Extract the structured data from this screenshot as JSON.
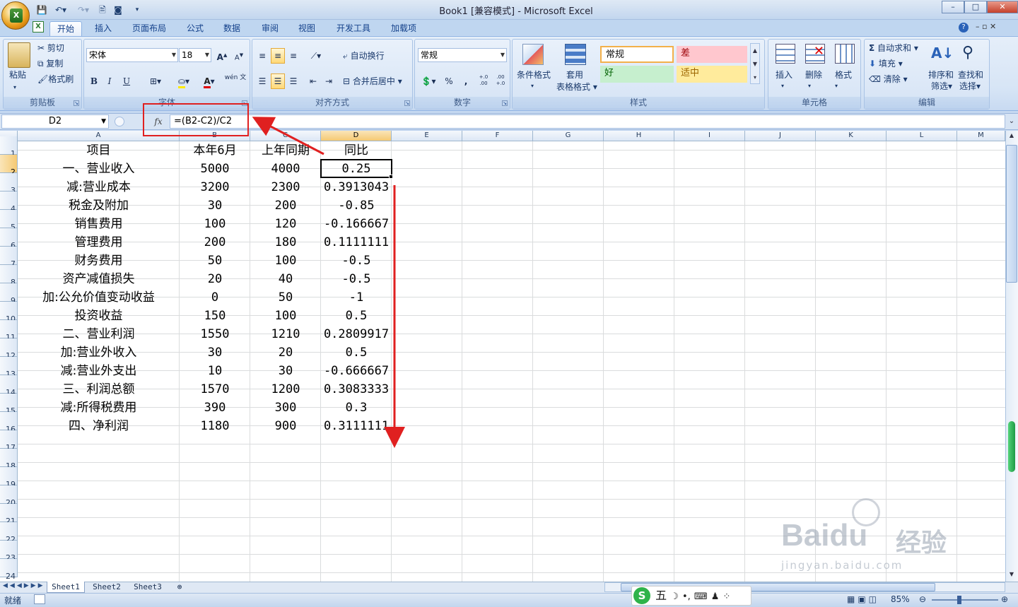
{
  "window": {
    "title": "Book1  [兼容模式] - Microsoft Excel",
    "min": "–",
    "max": "□",
    "close": "✕"
  },
  "office_button": {
    "label": "X"
  },
  "tabs": [
    "开始",
    "插入",
    "页面布局",
    "公式",
    "数据",
    "审阅",
    "视图",
    "开发工具",
    "加载项"
  ],
  "ribbon": {
    "clipboard": {
      "label": "剪贴板",
      "paste": "粘贴",
      "cut": "剪切",
      "copy": "复制",
      "format_painter": "格式刷"
    },
    "font": {
      "label": "字体",
      "font_name": "宋体",
      "font_size": "18",
      "bold": "B",
      "italic": "I",
      "underline": "U",
      "grow": "A",
      "shrink": "A",
      "wen": "wén 文"
    },
    "alignment": {
      "label": "对齐方式",
      "wrap": "自动换行",
      "merge": "合并后居中"
    },
    "number": {
      "label": "数字",
      "format": "常规",
      "percent": "%",
      "comma": ",",
      "inc": "+.0 .00",
      "dec": ".00 +.0"
    },
    "styles": {
      "label": "样式",
      "conditional": "条件格式",
      "table_top": "套用",
      "table_bottom": "表格格式",
      "normal": "常规",
      "bad": "差",
      "good": "好",
      "neutral": "适中"
    },
    "cells": {
      "label": "单元格",
      "insert": "插入",
      "delete": "删除",
      "format": "格式"
    },
    "editing": {
      "label": "编辑",
      "autosum": "自动求和",
      "fill": "填充",
      "clear": "清除",
      "sort_top": "排序和",
      "sort_bottom": "筛选",
      "find_top": "查找和",
      "find_bottom": "选择"
    }
  },
  "formula_bar": {
    "name_box": "D2",
    "fx": "fx",
    "formula": "=(B2-C2)/C2"
  },
  "columns": [
    "A",
    "B",
    "C",
    "D",
    "E",
    "F",
    "G",
    "H",
    "I",
    "J",
    "K",
    "L",
    "M"
  ],
  "rows": [
    "1",
    "2",
    "3",
    "4",
    "5",
    "6",
    "7",
    "8",
    "9",
    "10",
    "11",
    "12",
    "13",
    "14",
    "15",
    "16",
    "17",
    "18",
    "19",
    "20",
    "21",
    "22",
    "23",
    "24"
  ],
  "table": [
    [
      "项目",
      "本年6月",
      "上年同期",
      "同比"
    ],
    [
      "一、营业收入",
      "5000",
      "4000",
      "0.25"
    ],
    [
      "减:营业成本",
      "3200",
      "2300",
      "0.3913043"
    ],
    [
      "税金及附加",
      "30",
      "200",
      "-0.85"
    ],
    [
      "销售费用",
      "100",
      "120",
      "-0.166667"
    ],
    [
      "管理费用",
      "200",
      "180",
      "0.1111111"
    ],
    [
      "财务费用",
      "50",
      "100",
      "-0.5"
    ],
    [
      "资产减值损失",
      "20",
      "40",
      "-0.5"
    ],
    [
      "加:公允价值变动收益",
      "0",
      "50",
      "-1"
    ],
    [
      "投资收益",
      "150",
      "100",
      "0.5"
    ],
    [
      "二、营业利润",
      "1550",
      "1210",
      "0.2809917"
    ],
    [
      "加:营业外收入",
      "30",
      "20",
      "0.5"
    ],
    [
      "减:营业外支出",
      "10",
      "30",
      "-0.666667"
    ],
    [
      "三、利润总额",
      "1570",
      "1200",
      "0.3083333"
    ],
    [
      "减:所得税费用",
      "390",
      "300",
      "0.3"
    ],
    [
      "四、净利润",
      "1180",
      "900",
      "0.3111111"
    ]
  ],
  "sheets": [
    "Sheet1",
    "Sheet2",
    "Sheet3"
  ],
  "status": {
    "ready": "就绪",
    "zoom": "85%"
  },
  "ime": {
    "mode": "五"
  },
  "watermark": {
    "brand": "Baidu",
    "cn": "经验",
    "url": "jingyan.baidu.com"
  },
  "colors": {
    "annotation": "#e02020",
    "selected_header": "#f5c973",
    "ribbon": "#d7e5f6"
  }
}
